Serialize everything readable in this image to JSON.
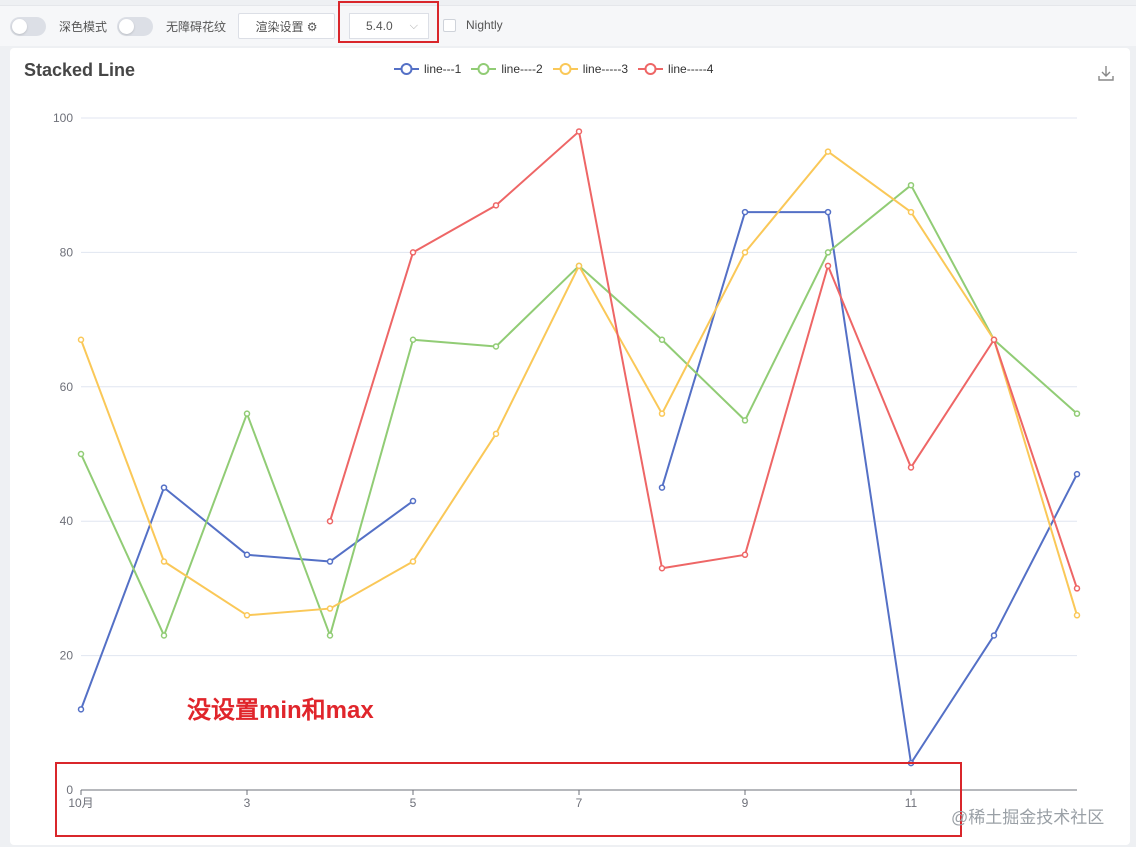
{
  "toolbar": {
    "dark_mode_label": "深色模式",
    "aria_label": "无障碍花纹",
    "render_settings_label": "渲染设置",
    "version_value": "5.4.0",
    "nightly_label": "Nightly"
  },
  "annotation": "没设置min和max",
  "watermark": "@稀土掘金技术社区",
  "colors": {
    "line1": "#5470c6",
    "line2": "#91cc75",
    "line3": "#fac858",
    "line4": "#ee6666",
    "annotation": "#e0252b"
  },
  "chart_data": {
    "type": "line",
    "title": "Stacked Line",
    "x": [
      1,
      2,
      3,
      4,
      5,
      6,
      7,
      8,
      9,
      10,
      11,
      12,
      13
    ],
    "x_tick_labels": [
      {
        "x": 1,
        "label": "10月"
      },
      {
        "x": 3,
        "label": "3"
      },
      {
        "x": 5,
        "label": "5"
      },
      {
        "x": 7,
        "label": "7"
      },
      {
        "x": 9,
        "label": "9"
      },
      {
        "x": 11,
        "label": "11"
      }
    ],
    "ylim": [
      0,
      100
    ],
    "y_ticks": [
      0,
      20,
      40,
      60,
      80,
      100
    ],
    "grid": true,
    "legend_position": "top-center",
    "series": [
      {
        "name": "line---1",
        "color": "#5470c6",
        "values": [
          12,
          45,
          35,
          34,
          43,
          null,
          null,
          45,
          86,
          86,
          4,
          23,
          47
        ]
      },
      {
        "name": "line----2",
        "color": "#91cc75",
        "values": [
          50,
          23,
          56,
          23,
          67,
          66,
          78,
          67,
          55,
          80,
          90,
          67,
          56
        ]
      },
      {
        "name": "line-----3",
        "color": "#fac858",
        "values": [
          67,
          34,
          26,
          27,
          34,
          53,
          78,
          56,
          80,
          95,
          86,
          67,
          26
        ]
      },
      {
        "name": "line-----4",
        "color": "#ee6666",
        "values": [
          null,
          null,
          null,
          40,
          80,
          87,
          98,
          33,
          35,
          78,
          48,
          67,
          30
        ]
      }
    ]
  }
}
